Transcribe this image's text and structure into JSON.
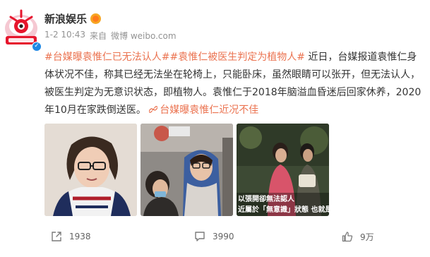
{
  "post": {
    "author": "新浪娱乐",
    "date": "1-2 10:43",
    "source_prefix": "来自",
    "source": "微博 weibo.com",
    "tag1": "#台媒曝袁惟仁已无法认人#",
    "tag2": "#袁惟仁被医生判定为植物人#",
    "body": " 近日，台媒报道袁惟仁身体状况不佳，称其已经无法坐在轮椅上，只能卧床，虽然眼睛可以张开，但无法认人，被医生判定为无意识状态，即植物人。袁惟仁于2018年脑溢血昏迷后回家休养，2020年10月在家跌倒送医。",
    "link_text": "台媒曝袁惟仁近况不佳",
    "image3_caption1": "以張開卻無法認人",
    "image3_caption2": "近屬於「無意識」狀態 也就是"
  },
  "footer": {
    "reposts": "1938",
    "comments": "3990",
    "likes": "9万"
  },
  "icons": [
    "sina-logo-icon",
    "verified-icon",
    "vip-icon",
    "link-icon",
    "repost-icon",
    "comment-icon",
    "like-icon"
  ],
  "colors": {
    "tag": "#eb7350",
    "meta": "#939393"
  }
}
